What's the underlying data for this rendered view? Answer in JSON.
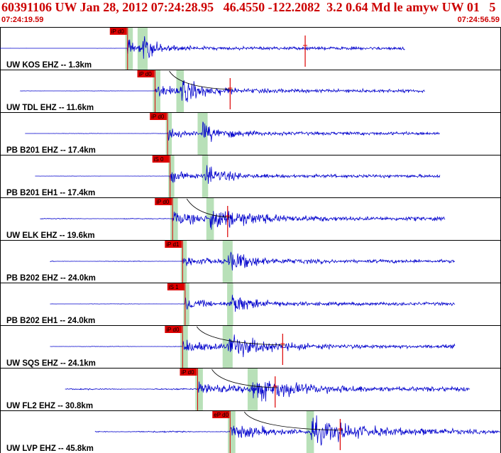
{
  "header": {
    "title": "60391106 UW Jan 28, 2012 07:24:28.95   46.4550 -122.2082  3.2 0.64 Md le amyw UW 01   5",
    "time_start": "07:24:19.59",
    "time_end": "07:24:56.59"
  },
  "colors": {
    "trace": "#0000cc",
    "pick": "#dd0000",
    "window": "#b8e0b8",
    "header_text": "#cc0000"
  },
  "traces": [
    {
      "label": "UW KOS EHZ -- 1.3km",
      "pick_label": "iP d0",
      "t_start": 0.0,
      "t_end": 0.81,
      "p_time": 0.255,
      "s_time": 0.285,
      "coda_end": 0.61,
      "noise": 0.02,
      "amp": 1.0,
      "decay": 8,
      "p_width": 0.015,
      "s_width": 0.02,
      "s_mark": 0.61,
      "coda_curve": false
    },
    {
      "label": "UW TDL EHZ -- 11.6km",
      "pick_label": "iP d0",
      "t_start": 0.04,
      "t_end": 0.85,
      "p_time": 0.31,
      "s_time": 0.36,
      "coda_end": 0.46,
      "noise": 0.08,
      "amp": 1.0,
      "decay": 5,
      "p_width": 0.015,
      "s_width": 0.015,
      "s_mark": 0.46,
      "coda_curve": true
    },
    {
      "label": "PB B201 EHZ -- 17.4km",
      "pick_label": "iP d0",
      "t_start": 0.05,
      "t_end": 0.88,
      "p_time": 0.335,
      "s_time": 0.405,
      "coda_end": 0.88,
      "noise": 0.08,
      "amp": 0.8,
      "decay": 6,
      "p_width": 0.012,
      "s_width": 0.02,
      "s_mark": null,
      "coda_curve": false
    },
    {
      "label": "PB B201 EH1 -- 17.4km",
      "pick_label": "iS 0",
      "t_start": 0.07,
      "t_end": 0.88,
      "p_time": 0.34,
      "s_time": 0.41,
      "coda_end": 0.88,
      "noise": 0.05,
      "amp": 1.0,
      "decay": 7,
      "p_width": 0.012,
      "s_width": 0.012,
      "s_mark": null,
      "coda_curve": false
    },
    {
      "label": "UW ELK EHZ -- 19.6km",
      "pick_label": "iP d0",
      "t_start": 0.08,
      "t_end": 0.89,
      "p_time": 0.345,
      "s_time": 0.42,
      "coda_end": 0.455,
      "noise": 0.18,
      "amp": 1.0,
      "decay": 3,
      "p_width": 0.015,
      "s_width": 0.015,
      "s_mark": 0.455,
      "coda_curve": true
    },
    {
      "label": "PB B202 EHZ -- 24.0km",
      "pick_label": "iP d1",
      "t_start": 0.1,
      "t_end": 0.91,
      "p_time": 0.365,
      "s_time": 0.455,
      "coda_end": 0.91,
      "noise": 0.12,
      "amp": 0.9,
      "decay": 5,
      "p_width": 0.012,
      "s_width": 0.02,
      "s_mark": null,
      "coda_curve": false
    },
    {
      "label": "PB B202 EH1 -- 24.0km",
      "pick_label": "iS 1",
      "t_start": 0.1,
      "t_end": 0.91,
      "p_time": 0.37,
      "s_time": 0.46,
      "coda_end": 0.91,
      "noise": 0.08,
      "amp": 1.0,
      "decay": 6,
      "p_width": 0.012,
      "s_width": 0.012,
      "s_mark": null,
      "coda_curve": false
    },
    {
      "label": "UW SQS EHZ -- 24.1km",
      "pick_label": "iP d0",
      "t_start": 0.1,
      "t_end": 0.91,
      "p_time": 0.365,
      "s_time": 0.455,
      "coda_end": 0.565,
      "noise": 0.12,
      "amp": 1.0,
      "decay": 3.5,
      "p_width": 0.015,
      "s_width": 0.02,
      "s_mark": 0.565,
      "coda_curve": true
    },
    {
      "label": "UW FL2 EHZ -- 30.8km",
      "pick_label": "iP d0",
      "t_start": 0.13,
      "t_end": 0.94,
      "p_time": 0.395,
      "s_time": 0.505,
      "coda_end": 0.55,
      "noise": 0.3,
      "amp": 0.9,
      "decay": 2.5,
      "p_width": 0.015,
      "s_width": 0.02,
      "s_mark": 0.55,
      "coda_curve": true
    },
    {
      "label": "UW LVP EHZ -- 45.8km",
      "pick_label": "eP d0",
      "t_start": 0.19,
      "t_end": 1.0,
      "p_time": 0.46,
      "s_time": 0.62,
      "coda_end": 0.68,
      "noise": 0.35,
      "amp": 1.0,
      "decay": 2.5,
      "p_width": 0.015,
      "s_width": 0.015,
      "s_mark": 0.68,
      "coda_curve": true
    }
  ]
}
